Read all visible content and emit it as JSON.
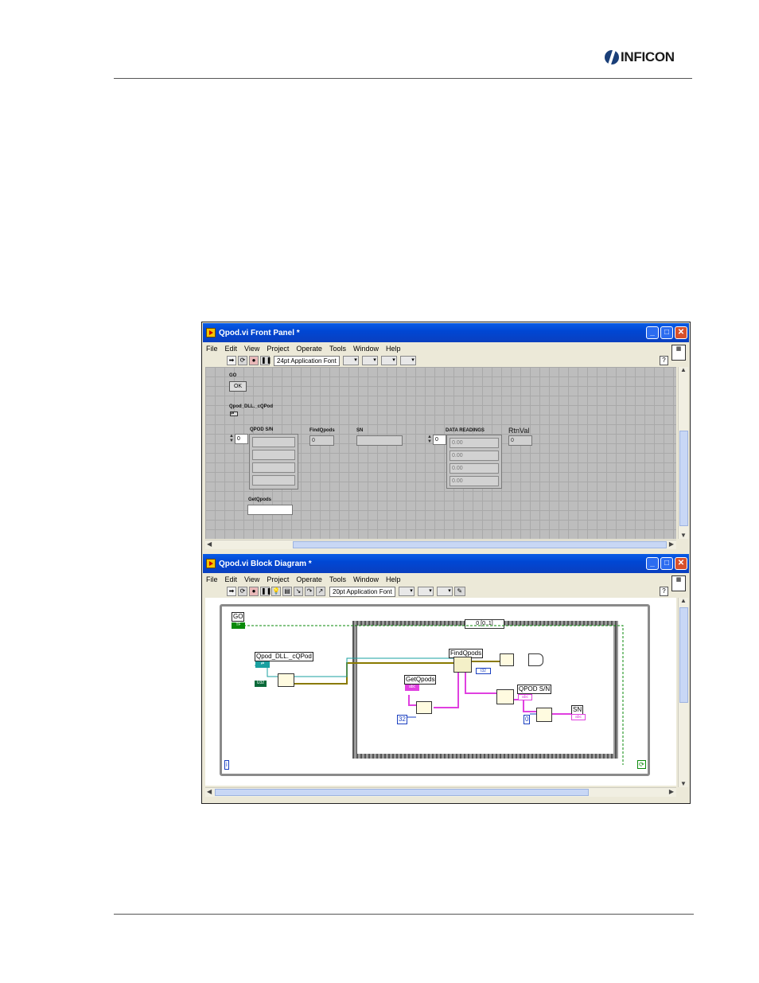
{
  "page": {
    "brand": "INFICON"
  },
  "front_panel": {
    "title": "Qpod.vi Front Panel *",
    "menu": [
      "File",
      "Edit",
      "View",
      "Project",
      "Operate",
      "Tools",
      "Window",
      "Help"
    ],
    "font_select": "24pt Application Font",
    "controls": {
      "go_label": "GO",
      "ok_label": "OK",
      "refnum_label": "Qpod_DLL._cQPod",
      "qpod_sn_label": "QPOD S/N",
      "qpod_sn_index": "0",
      "findqpods_label": "FindQpods",
      "findqpods_value": "0",
      "sn_label": "SN",
      "data_readings_label": "DATA READINGS",
      "data_readings_index": "0",
      "data_readings_values": [
        "0.00",
        "0.00",
        "0.00",
        "0.00"
      ],
      "rtnval_label": "RtnVal",
      "rtnval_value": "0",
      "getqpods_label": "GetQpods"
    }
  },
  "block_diagram": {
    "title": "Qpod.vi Block Diagram *",
    "menu": [
      "File",
      "Edit",
      "View",
      "Project",
      "Operate",
      "Tools",
      "Window",
      "Help"
    ],
    "font_select": "20pt Application Font",
    "case_selector": "0 [0..1]",
    "labels": {
      "go": "GO",
      "go_term": "TF",
      "refnum": "Qpod_DLL._cQPod",
      "const_num": "U32",
      "findqpods": "FindQpods",
      "findqpods_term": "I32",
      "getqpods": "GetQpods",
      "getqpods_term": "abc",
      "const_32": "32",
      "qpod_sn": "QPOD S/N",
      "qpod_sn_term": "abc",
      "const_0": "0",
      "sn": "SN",
      "sn_term": "abc",
      "iteration": "i"
    }
  },
  "colors": {
    "titlebar": "#0047d4",
    "canvas_grid": "#bdbdbd",
    "wire_string": "#e040e0",
    "wire_refnum": "#1aa0a0",
    "wire_bool": "#0a8a0a",
    "wire_cluster": "#8a7a00"
  }
}
